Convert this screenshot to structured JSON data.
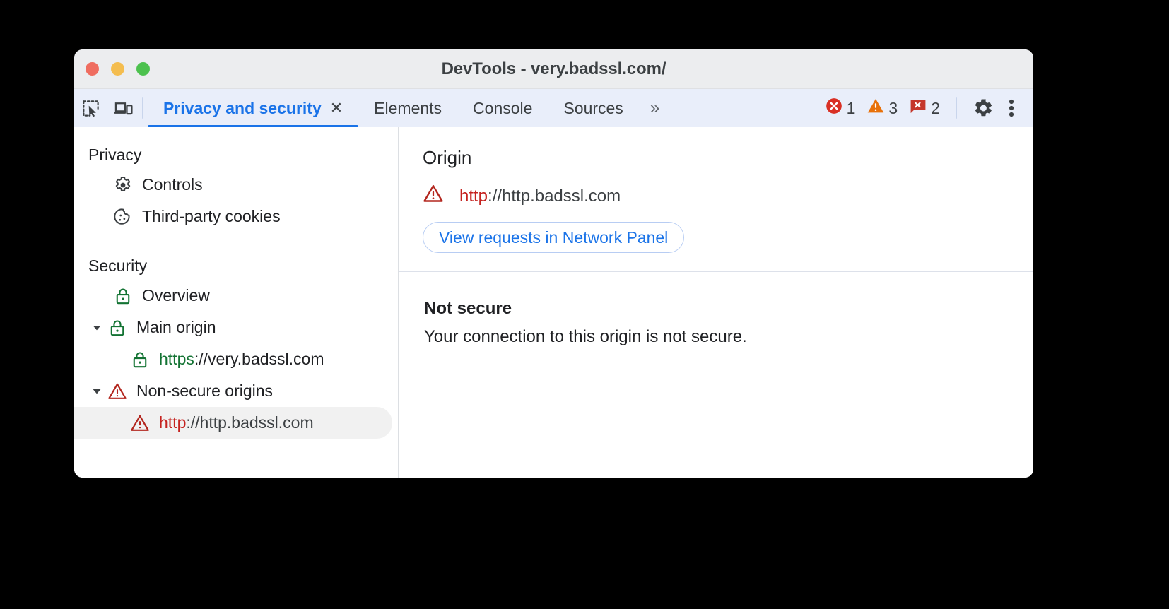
{
  "window": {
    "title": "DevTools - very.badssl.com/",
    "traffic_lights": [
      "close",
      "minimize",
      "maximize"
    ]
  },
  "toolbar": {
    "inspect_icon": "inspect-element-icon",
    "device_icon": "device-toolbar-icon",
    "tabs": [
      {
        "label": "Privacy and security",
        "active": true,
        "closable": true,
        "close_label": "✕"
      },
      {
        "label": "Elements",
        "active": false,
        "closable": false
      },
      {
        "label": "Console",
        "active": false,
        "closable": false
      },
      {
        "label": "Sources",
        "active": false,
        "closable": false
      }
    ],
    "overflow_label": "»",
    "counters": [
      {
        "name": "errors",
        "icon": "error-circle-icon",
        "count": "1",
        "color": "#d93025"
      },
      {
        "name": "warnings",
        "icon": "warning-triangle-icon",
        "count": "3",
        "color": "#e8710a"
      },
      {
        "name": "issues",
        "icon": "issue-message-icon",
        "count": "2",
        "color": "#c5372c"
      }
    ],
    "settings_icon": "gear-icon",
    "more_icon": "kebab-menu-icon"
  },
  "sidebar": {
    "groups": [
      {
        "title": "Privacy",
        "items": [
          {
            "label": "Controls",
            "icon": "gear-icon",
            "indent": 1,
            "twisty": "",
            "selected": false
          },
          {
            "label": "Third-party cookies",
            "icon": "cookie-icon",
            "indent": 1,
            "twisty": "",
            "selected": false
          }
        ]
      },
      {
        "title": "Security",
        "items": [
          {
            "label": "Overview",
            "icon": "lock-green-icon",
            "indent": 1,
            "twisty": "",
            "selected": false
          },
          {
            "label": "Main origin",
            "icon": "lock-green-icon",
            "indent": 0,
            "twisty": "expanded",
            "selected": false
          },
          {
            "scheme": "https",
            "rest": "://very.badssl.com",
            "icon": "lock-green-icon",
            "indent": 2,
            "twisty": "",
            "selected": false
          },
          {
            "label": "Non-secure origins",
            "icon": "warning-triangle-red-icon",
            "indent": 0,
            "twisty": "expanded",
            "selected": false
          },
          {
            "scheme": "http",
            "rest": "://http.badssl.com",
            "icon": "warning-triangle-red-icon",
            "indent": 2,
            "twisty": "",
            "selected": true
          }
        ]
      }
    ]
  },
  "main": {
    "origin": {
      "heading": "Origin",
      "url_scheme": "http",
      "url_rest": "://http.badssl.com",
      "url_icon": "warning-triangle-red-icon",
      "button_label": "View requests in Network Panel"
    },
    "summary": {
      "title": "Not secure",
      "text": "Your connection to this origin is not secure."
    }
  },
  "colors": {
    "accent_blue": "#1a73e8",
    "secure_green": "#137333",
    "insecure_red": "#c5221f",
    "warning_orange": "#e8710a",
    "toolbar_bg": "#e9eefa",
    "titlebar_bg": "#ecedef"
  }
}
